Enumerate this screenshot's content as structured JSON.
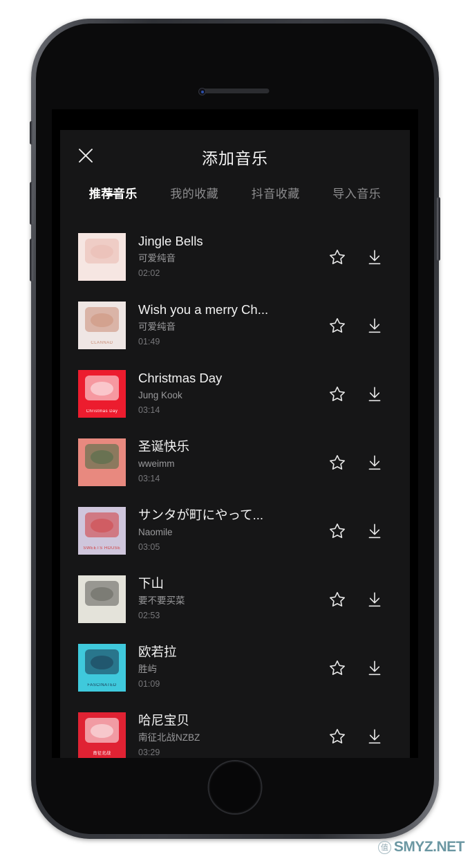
{
  "app": {
    "sheet_title": "添加音乐",
    "close_icon": "close-icon"
  },
  "tabs": [
    {
      "label": "推荐音乐",
      "active": true
    },
    {
      "label": "我的收藏",
      "active": false
    },
    {
      "label": "抖音收藏",
      "active": false
    },
    {
      "label": "导入音乐",
      "active": false
    }
  ],
  "actions": {
    "favorite_icon": "star-outline-icon",
    "download_icon": "download-icon"
  },
  "songs": [
    {
      "title": "Jingle Bells",
      "artist": "可爱纯音",
      "duration": "02:02",
      "cover": {
        "bg": "#f6e6e2",
        "accent": "#e9b8ae",
        "caption": ""
      }
    },
    {
      "title": "Wish you a merry Ch...",
      "artist": "可爱纯音",
      "duration": "01:49",
      "cover": {
        "bg": "#efe6e4",
        "accent": "#c98b74",
        "caption": "CLANNAD"
      }
    },
    {
      "title": "Christmas Day",
      "artist": "Jung Kook",
      "duration": "03:14",
      "cover": {
        "bg": "#ec1c2e",
        "accent": "#ffffff",
        "caption": "Christmas Day"
      }
    },
    {
      "title": "圣诞快乐",
      "artist": "wweimm",
      "duration": "03:14",
      "cover": {
        "bg": "#e8897f",
        "accent": "#3f6b44",
        "caption": ""
      }
    },
    {
      "title": "サンタが町にやって...",
      "artist": "Naomile",
      "duration": "03:05",
      "cover": {
        "bg": "#cfc6dc",
        "accent": "#d13b3b",
        "caption": "SWEETS HOUSE"
      }
    },
    {
      "title": "下山",
      "artist": "要不要买菜",
      "duration": "02:53",
      "cover": {
        "bg": "#e4e3da",
        "accent": "#5a5a55",
        "caption": ""
      }
    },
    {
      "title": "欧若拉",
      "artist": "胜屿",
      "duration": "01:09",
      "cover": {
        "bg": "#3fc9dc",
        "accent": "#18324a",
        "caption": "FASCINATED"
      }
    },
    {
      "title": "哈尼宝贝",
      "artist": "南征北战NZBZ",
      "duration": "03:29",
      "cover": {
        "bg": "#e02233",
        "accent": "#ffffff",
        "caption": "南征北战"
      }
    }
  ],
  "watermark": {
    "badge": "值",
    "text": "SMYZ.NET"
  },
  "colors": {
    "sheet_bg": "#161617",
    "screen_bg": "#000000",
    "accent_underline": "#ffffff",
    "title_text": "#f3f3f3",
    "secondary_text": "#9a9a9c"
  }
}
